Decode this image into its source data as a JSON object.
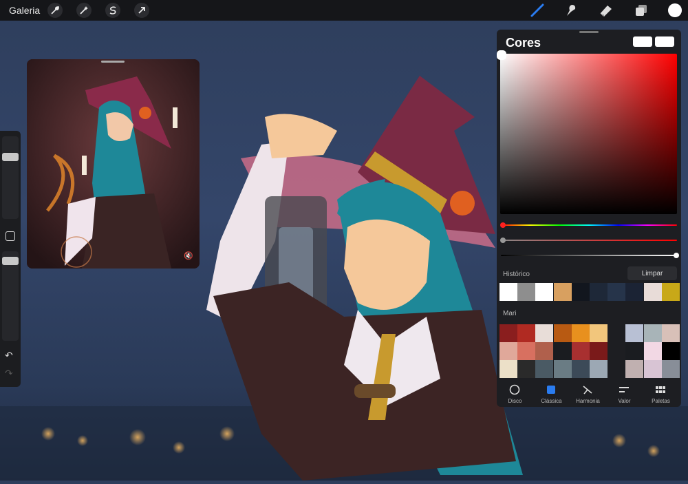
{
  "topbar": {
    "gallery_label": "Galeria",
    "left_tools": [
      "wrench-icon",
      "magic-wand-icon",
      "selection-icon",
      "transform-arrow-icon"
    ],
    "right_tools": [
      "brush-icon",
      "smudge-icon",
      "eraser-icon",
      "layers-icon",
      "color-swatch-icon"
    ],
    "active_color": "#ffffff"
  },
  "colors_panel": {
    "title": "Cores",
    "current_color": "#ffffff",
    "previous_color": "#ffffff",
    "hue_hex": "#ff0000",
    "history": {
      "label": "Histórico",
      "clear_label": "Limpar",
      "swatches": [
        "#ffffff",
        "#8e8e8e",
        "#ffffff",
        "#d8a060",
        "#12161e",
        "#1e2838",
        "#26344a",
        "#1b2334",
        "#e8dcd8",
        "#c8a818"
      ]
    },
    "palette": {
      "label": "Mari",
      "rows": [
        [
          "#8a1e1e",
          "#b02a22",
          "#e8ddd8",
          "#b85a12",
          "#e8901e",
          "#f2c67c",
          "#1d1e22",
          "#b8c0d4",
          "#a8b4b8",
          "#d8c0b8"
        ],
        [
          "#e0a89a",
          "#d87060",
          "#b0604c",
          "#1a1c20",
          "#a83030",
          "#7a1a1a",
          "#1d1e22",
          "#1a1c20",
          "#f2d8e4",
          "#000000"
        ],
        [
          "#ece0c8",
          "#2a2a2a",
          "#4a5a64",
          "#6a7c84",
          "#3c4a58",
          "#9ca8b4",
          "#1d1e22",
          "#c0b0b0",
          "#d8c4d4",
          "#888e98"
        ]
      ]
    },
    "tabs": [
      {
        "label": "Disco",
        "icon": "disc-icon",
        "active": false
      },
      {
        "label": "Clássica",
        "icon": "classic-square-icon",
        "active": true
      },
      {
        "label": "Harmonia",
        "icon": "harmony-icon",
        "active": false
      },
      {
        "label": "Valor",
        "icon": "value-sliders-icon",
        "active": false
      },
      {
        "label": "Paletas",
        "icon": "palettes-grid-icon",
        "active": false
      }
    ]
  },
  "reference_window": {
    "mute_icon": "speaker-mute-icon"
  },
  "side_bar": {
    "undo_icon": "undo-icon",
    "redo_icon": "redo-icon",
    "modify_button_icon": "square-modify-icon"
  }
}
